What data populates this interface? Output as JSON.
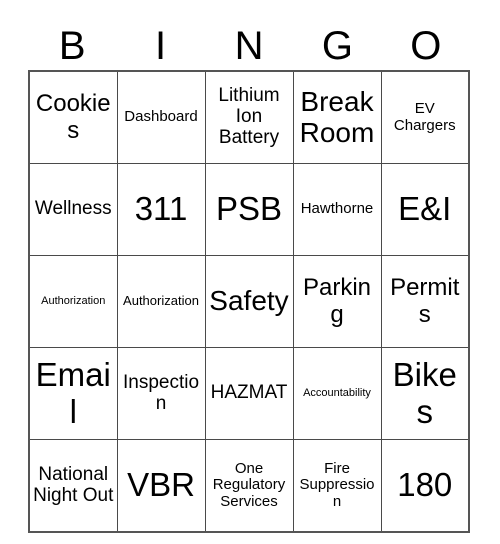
{
  "card": {
    "header_letters": [
      "B",
      "I",
      "N",
      "G",
      "O"
    ],
    "columns": 5,
    "rows": 5,
    "border_color": "#4a4a4a",
    "text_color": "#000000",
    "background_color": "#ffffff",
    "cells": [
      [
        {
          "text": "Cookies",
          "size": "sz-lg"
        },
        {
          "text": "Dashboard",
          "size": "sz-sm"
        },
        {
          "text": "Lithium Ion Battery",
          "size": "sz-md"
        },
        {
          "text": "Break Room",
          "size": "sz-xl"
        },
        {
          "text": "EV Chargers",
          "size": "sz-sm"
        }
      ],
      [
        {
          "text": "Wellness",
          "size": "sz-md"
        },
        {
          "text": "311",
          "size": "sz-xxl"
        },
        {
          "text": "PSB",
          "size": "sz-xxl"
        },
        {
          "text": "Hawthorne",
          "size": "sz-sm"
        },
        {
          "text": "E&I",
          "size": "sz-xxl"
        }
      ],
      [
        {
          "text": "Authorization",
          "size": "sz-xxs"
        },
        {
          "text": "Authorization",
          "size": "sz-xs"
        },
        {
          "text": "Safety",
          "size": "sz-xl"
        },
        {
          "text": "Parking",
          "size": "sz-lg"
        },
        {
          "text": "Permits",
          "size": "sz-lg"
        }
      ],
      [
        {
          "text": "Email",
          "size": "sz-xxl"
        },
        {
          "text": "Inspection",
          "size": "sz-md"
        },
        {
          "text": "HAZMAT",
          "size": "sz-md"
        },
        {
          "text": "Accountability",
          "size": "sz-xxs"
        },
        {
          "text": "Bikes",
          "size": "sz-xxl"
        }
      ],
      [
        {
          "text": "National Night Out",
          "size": "sz-md"
        },
        {
          "text": "VBR",
          "size": "sz-xxl"
        },
        {
          "text": "One Regulatory Services",
          "size": "sz-sm"
        },
        {
          "text": "Fire Suppression",
          "size": "sz-sm"
        },
        {
          "text": "180",
          "size": "sz-xxl"
        }
      ]
    ]
  }
}
